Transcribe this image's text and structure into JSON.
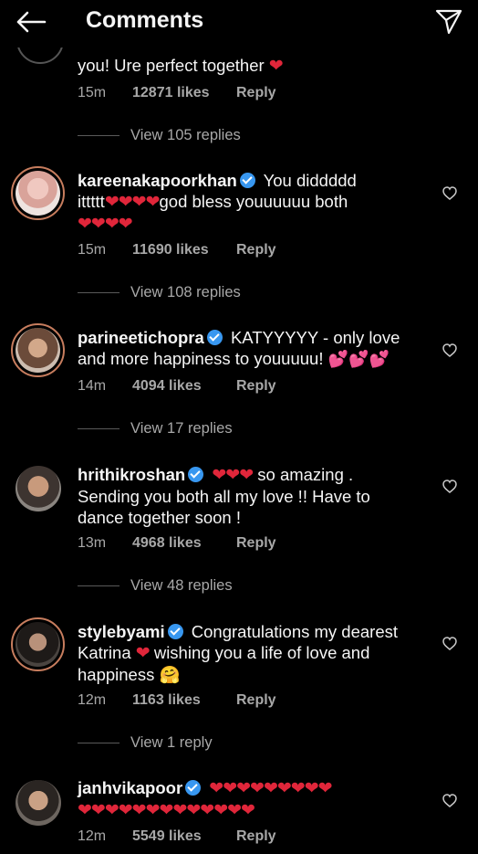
{
  "header": {
    "title": "Comments"
  },
  "comments": [
    {
      "text": "you! Ure perfect together",
      "time": "15m",
      "likes": "12871 likes",
      "reply": "Reply",
      "view_replies": "View 105 replies"
    },
    {
      "username": "kareenakapoorkhan",
      "text1": "You diddddd",
      "text2": "ittttt",
      "text3": "god bless youuuuuu both",
      "time": "15m",
      "likes": "11690 likes",
      "reply": "Reply",
      "view_replies": "View 108 replies"
    },
    {
      "username": "parineetichopra",
      "text1": "KATYYYYY - only love",
      "text2": "and more happiness to youuuuu!",
      "time": "14m",
      "likes": "4094 likes",
      "reply": "Reply",
      "view_replies": "View 17 replies"
    },
    {
      "username": "hrithikroshan",
      "text1": "so amazing .",
      "text2": "Sending you both all my love !! Have to",
      "text3": "dance together soon !",
      "time": "13m",
      "likes": "4968 likes",
      "reply": "Reply",
      "view_replies": "View 48 replies"
    },
    {
      "username": "stylebyami",
      "text1": "Congratulations my dearest",
      "text2": "Katrina",
      "text3": "wishing you a life of love and",
      "text4": "happiness",
      "time": "12m",
      "likes": "1163 likes",
      "reply": "Reply",
      "view_replies": "View 1 reply"
    },
    {
      "username": "janhvikapoor",
      "time": "12m",
      "likes": "5549 likes",
      "reply": "Reply"
    }
  ],
  "icons": {
    "back": "back-arrow-icon",
    "send": "direct-send-icon",
    "like": "heart-outline-icon",
    "verified": "verified-badge-icon"
  },
  "colors": {
    "background": "#000000",
    "verified": "#3897f0",
    "heart": "#e0263a",
    "muted": "#a8a8a8"
  }
}
